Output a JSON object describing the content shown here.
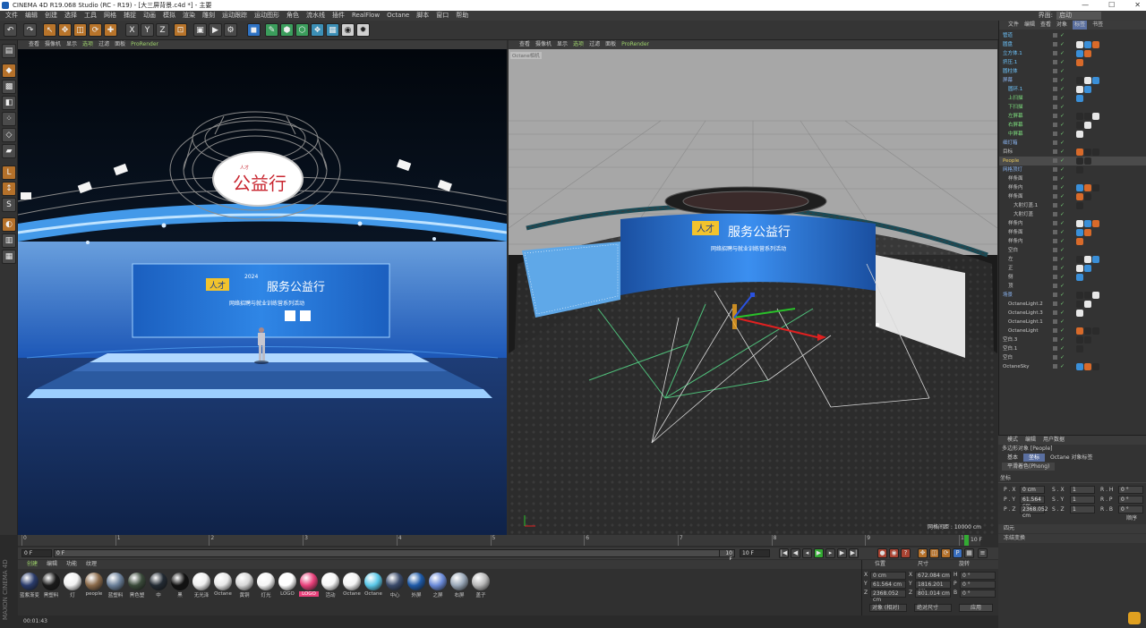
{
  "window": {
    "title": "CINEMA 4D R19.068 Studio (RC - R19) - [大三屏背景.c4d *] - 主要",
    "buttons": [
      "—",
      "☐",
      "✕"
    ]
  },
  "menu": [
    "文件",
    "编辑",
    "创建",
    "选择",
    "工具",
    "网格",
    "捕捉",
    "动画",
    "模拟",
    "渲染",
    "雕刻",
    "运动跟踪",
    "运动图形",
    "角色",
    "流水线",
    "插件",
    "RealFlow",
    "Octane",
    "脚本",
    "窗口",
    "帮助"
  ],
  "layout": {
    "label": "界面:",
    "value": "启动"
  },
  "viewport_left": {
    "menu": [
      "查看",
      "摄像机",
      "显示",
      "选项",
      "过滤",
      "面板",
      "ProRender"
    ],
    "scene": {
      "logo_text": "公益行",
      "logo_small": "人才",
      "screen_badge": "人才",
      "screen_year": "2024",
      "screen_title": "服务公益行",
      "screen_subtitle": "网络招聘与就业训练营系列活动"
    }
  },
  "viewport_right": {
    "menu": [
      "查看",
      "摄像机",
      "显示",
      "选项",
      "过滤",
      "面板",
      "ProRender"
    ],
    "camera_label": "Octane相机",
    "grid_info": "网格间距 : 10000 cm",
    "scene": {
      "screen_badge": "人才",
      "screen_title": "服务公益行",
      "screen_subtitle": "网络招聘与就业训练营系列活动"
    }
  },
  "object_manager": {
    "menu": [
      "文件",
      "编辑",
      "查看",
      "对象",
      "标签",
      "书签"
    ],
    "objects": [
      {
        "name": "管道",
        "indent": 0,
        "color": "#6ec6ff"
      },
      {
        "name": "圆盘",
        "indent": 0,
        "color": "#6ec6ff"
      },
      {
        "name": "立方体.1",
        "indent": 0,
        "color": "#6ec6ff"
      },
      {
        "name": "挤压.1",
        "indent": 0,
        "color": "#6ec6ff"
      },
      {
        "name": "圆柱体",
        "indent": 0,
        "color": "#6ec6ff"
      },
      {
        "name": "屏幕",
        "indent": 0,
        "color": "#8ab4f0"
      },
      {
        "name": "圆环.1",
        "indent": 1,
        "color": "#6ec6ff"
      },
      {
        "name": "上扫描",
        "indent": 1,
        "color": "#7ee07e"
      },
      {
        "name": "下扫描",
        "indent": 1,
        "color": "#7ee07e"
      },
      {
        "name": "左屏幕",
        "indent": 1,
        "color": "#7ee07e"
      },
      {
        "name": "右屏幕",
        "indent": 1,
        "color": "#7ee07e"
      },
      {
        "name": "中屏幕",
        "indent": 1,
        "color": "#7ee07e"
      },
      {
        "name": "细灯箱",
        "indent": 0,
        "color": "#8ab4f0"
      },
      {
        "name": "目标",
        "indent": 0,
        "color": "#c8c8c8"
      },
      {
        "name": "People",
        "indent": 0,
        "color": "#e8c85a"
      },
      {
        "name": "网格顶灯",
        "indent": 0,
        "color": "#8ab4f0"
      },
      {
        "name": "样条面",
        "indent": 1,
        "color": "#c8c8c8"
      },
      {
        "name": "样条内",
        "indent": 1,
        "color": "#c8c8c8"
      },
      {
        "name": "样条面",
        "indent": 1,
        "color": "#c8c8c8"
      },
      {
        "name": "大射灯盖.1",
        "indent": 2,
        "color": "#c8c8c8"
      },
      {
        "name": "大射灯盖",
        "indent": 2,
        "color": "#c8c8c8"
      },
      {
        "name": "样条内",
        "indent": 1,
        "color": "#c8c8c8"
      },
      {
        "name": "样条面",
        "indent": 1,
        "color": "#c8c8c8"
      },
      {
        "name": "样条内",
        "indent": 1,
        "color": "#c8c8c8"
      },
      {
        "name": "空白",
        "indent": 1,
        "color": "#c8c8c8"
      },
      {
        "name": "左",
        "indent": 1,
        "color": "#c8c8c8"
      },
      {
        "name": "正",
        "indent": 1,
        "color": "#c8c8c8"
      },
      {
        "name": "侧",
        "indent": 1,
        "color": "#c8c8c8"
      },
      {
        "name": "顶",
        "indent": 1,
        "color": "#c8c8c8"
      },
      {
        "name": "场景",
        "indent": 0,
        "color": "#8ab4f0"
      },
      {
        "name": "OctaneLight.2",
        "indent": 1,
        "color": "#c8c8c8"
      },
      {
        "name": "OctaneLight.3",
        "indent": 1,
        "color": "#c8c8c8"
      },
      {
        "name": "OctaneLight.1",
        "indent": 1,
        "color": "#c8c8c8"
      },
      {
        "name": "OctaneLight",
        "indent": 1,
        "color": "#c8c8c8"
      },
      {
        "name": "空白.3",
        "indent": 0,
        "color": "#c8c8c8"
      },
      {
        "name": "空白.1",
        "indent": 0,
        "color": "#c8c8c8"
      },
      {
        "name": "空白",
        "indent": 0,
        "color": "#c8c8c8"
      },
      {
        "name": "OctaneSky",
        "indent": 0,
        "color": "#c8c8c8"
      }
    ]
  },
  "attribute_manager": {
    "menu": [
      "模式",
      "编辑",
      "用户数据"
    ],
    "object_label": "多边形对象 [People]",
    "tabs": [
      "基本",
      "坐标",
      "Octane 对象标签"
    ],
    "active_tab": "坐标",
    "phong_tab": "平滑着色(Phong)",
    "section": "坐标",
    "rows": [
      {
        "p": "P . X",
        "pv": "0 cm",
        "s": "S . X",
        "sv": "1",
        "r": "R . H",
        "rv": "0 °"
      },
      {
        "p": "P . Y",
        "pv": "61.564 cm",
        "s": "S . Y",
        "sv": "1",
        "r": "R . P",
        "rv": "0 °"
      },
      {
        "p": "P . Z",
        "pv": "2368.052 cm",
        "s": "S . Z",
        "sv": "1",
        "r": "R . B",
        "rv": "0 °"
      }
    ],
    "order_label": "顺序",
    "sections": [
      "四元",
      "冻结变换"
    ]
  },
  "timeline": {
    "ticks": [
      "0",
      "1",
      "2",
      "3",
      "4",
      "5",
      "6",
      "7",
      "8",
      "9",
      "10"
    ],
    "current_frame": "0 F",
    "end_frame_right": "10 F",
    "start_field": "0 F",
    "range_field": "0 F",
    "end_field": "10 F",
    "end_field2": "10 F"
  },
  "material_manager": {
    "tabs": [
      "创建",
      "编辑",
      "功能",
      "纹理"
    ],
    "materials": [
      {
        "name": "蓝紫渐变",
        "color": "#2a3b6b"
      },
      {
        "name": "黑塑料",
        "color": "#1a1a1a"
      },
      {
        "name": "灯",
        "color": "#f2f2f2"
      },
      {
        "name": "people",
        "color": "#8a6a4a"
      },
      {
        "name": "蓝塑料",
        "color": "#6a7f99"
      },
      {
        "name": "黑色塑",
        "color": "#3a4a3a"
      },
      {
        "name": "中",
        "color": "#222a33"
      },
      {
        "name": "黑",
        "color": "#111"
      },
      {
        "name": "无光泽",
        "color": "#f0f0f0"
      },
      {
        "name": "Octane",
        "color": "#e8e8e8"
      },
      {
        "name": "黄铜",
        "color": "#d8d8d8"
      },
      {
        "name": "灯光",
        "color": "#f5f5f5"
      },
      {
        "name": "LOGO",
        "color": "#ffffff"
      },
      {
        "name": "LOGO",
        "color": "#e8407a"
      },
      {
        "name": "活动",
        "color": "#f7f7f7"
      },
      {
        "name": "Octane",
        "color": "#f4f4f4"
      },
      {
        "name": "Octane",
        "color": "#5ac8e8"
      },
      {
        "name": "中心",
        "color": "#3a4a6a"
      },
      {
        "name": "外屏",
        "color": "#1e5aa8"
      },
      {
        "name": "之屏",
        "color": "#6a8ad8"
      },
      {
        "name": "右屏",
        "color": "#9aa8b8"
      },
      {
        "name": "盖子",
        "color": "#b8b8b8"
      }
    ]
  },
  "coordinates": {
    "headers": [
      "位置",
      "尺寸",
      "旋转"
    ],
    "rows": [
      {
        "a": "X",
        "av": "0 cm",
        "b": "X",
        "bv": "672.084 cm",
        "c": "H",
        "cv": "0 °"
      },
      {
        "a": "Y",
        "av": "61.564 cm",
        "b": "Y",
        "bv": "1816.201 cm",
        "c": "P",
        "cv": "0 °"
      },
      {
        "a": "Z",
        "av": "2368.052 cm",
        "b": "Z",
        "bv": "801.014 cm",
        "c": "B",
        "cv": "0 °"
      }
    ],
    "mode": "对象 (相对)",
    "size_mode": "绝对尺寸",
    "apply": "应用"
  },
  "status": {
    "time": "00:01:43"
  },
  "brand": {
    "vertical": "MAXON CINEMA 4D"
  }
}
